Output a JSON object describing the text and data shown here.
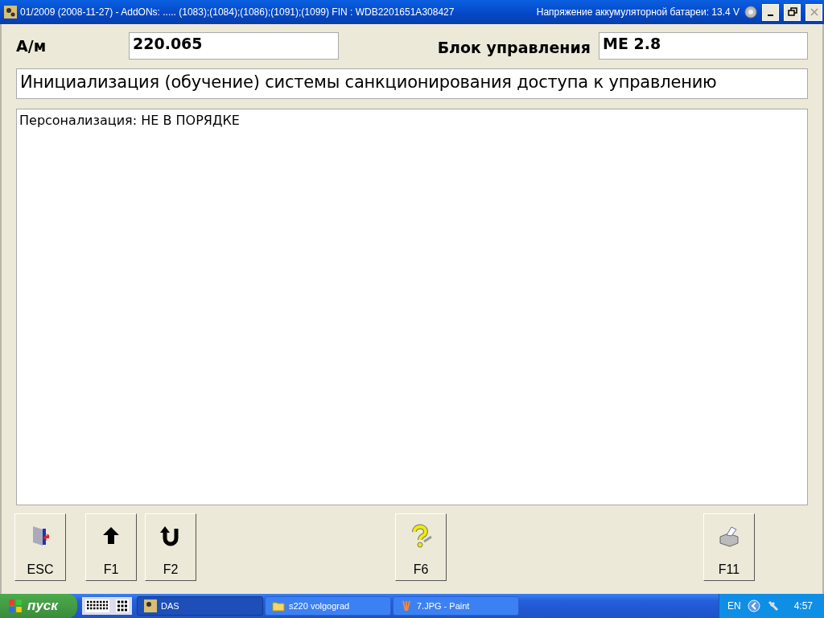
{
  "window": {
    "title": "01/2009 (2008-11-27) - AddONs: ..... (1083);(1084);(1086);(1091);(1099)  FIN : WDB2201651A308427",
    "battery": "Напряжение аккумуляторной батареи: 13.4 V"
  },
  "header": {
    "vehicle_label": "А/м",
    "vehicle_value": "220.065",
    "unit_label": "Блок управления",
    "unit_value": "ME 2.8"
  },
  "heading": "Инициализация (обучение) системы санкционирования доступа к управлению",
  "message": "Персонализация: НЕ В ПОРЯДКЕ",
  "buttons": [
    {
      "label": "ESC",
      "kind": "exit"
    },
    {
      "label": "F1",
      "kind": "up"
    },
    {
      "label": "F2",
      "kind": "back"
    },
    {
      "label": "F6",
      "kind": "help"
    },
    {
      "label": "F11",
      "kind": "print"
    }
  ],
  "taskbar": {
    "start": "пуск",
    "tasks": [
      {
        "label": "DAS",
        "kind": "app",
        "selected": true
      },
      {
        "label": "s220 volgograd",
        "kind": "folder",
        "selected": false
      },
      {
        "label": "7.JPG - Paint",
        "kind": "paint",
        "selected": false
      }
    ],
    "language": "EN",
    "clock": "4:57"
  }
}
